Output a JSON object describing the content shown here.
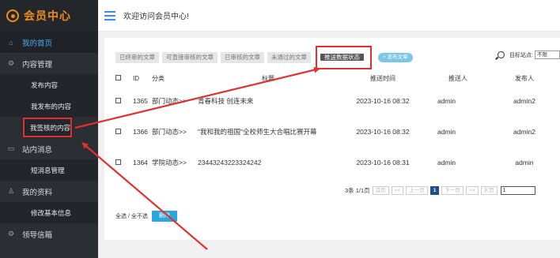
{
  "brand": {
    "title": "会员中心"
  },
  "header": {
    "welcome": "欢迎访问会员中心!"
  },
  "sidebar": {
    "items": [
      {
        "label": "我的首页",
        "icon": "home-icon"
      },
      {
        "label": "内容管理",
        "icon": "gear-icon",
        "children": [
          "发布内容",
          "我发布的内容",
          "我签核的内容"
        ]
      },
      {
        "label": "站内消息",
        "icon": "message-icon",
        "children": [
          "短消息管理"
        ]
      },
      {
        "label": "我的资料",
        "icon": "user-icon",
        "children": [
          "修改基本信息"
        ]
      },
      {
        "label": "领导信箱",
        "icon": "gear-icon"
      }
    ]
  },
  "toolbar": {
    "tabs": [
      "已终审的文章",
      "可直接审核的文章",
      "已审核的文章",
      "未通过的文章"
    ],
    "push_status": "推送数据状态",
    "publish": "+ 发布文章",
    "site_label": "目标站点:",
    "site_value": "不限"
  },
  "table": {
    "headers": [
      "ID",
      "分类",
      "标题",
      "推送时间",
      "推送人",
      "发布人"
    ],
    "rows": [
      {
        "id": "1365",
        "category": "部门动态>>",
        "title": "青春科技 创连未来",
        "time": "2023-10-16 08:32",
        "pusher": "admin",
        "publisher": "admin2"
      },
      {
        "id": "1366",
        "category": "部门动态>>",
        "title": "\"我和我的祖国\"全校师生大合唱比赛开幕",
        "time": "2023-10-16 08:32",
        "pusher": "admin",
        "publisher": "admin2"
      },
      {
        "id": "1364",
        "category": "学院动态>>",
        "title": "23443243223324242",
        "time": "2023-10-16 08:31",
        "pusher": "admin",
        "publisher": "admin"
      }
    ]
  },
  "pager": {
    "summary": "3条 1/1页",
    "first": "首页",
    "prev_group": "<<",
    "prev": "上一页",
    "current": "1",
    "next": "下一页",
    "next_group": ">>",
    "last": "末页",
    "jump_value": "1"
  },
  "bulk": {
    "select_all": "全选 / 全不选",
    "delete": "删除"
  },
  "colors": {
    "accent": "#f08c1a",
    "highlight": "#e03030",
    "sidebar_bg": "#2b2f33",
    "link": "#4aa8e8"
  }
}
